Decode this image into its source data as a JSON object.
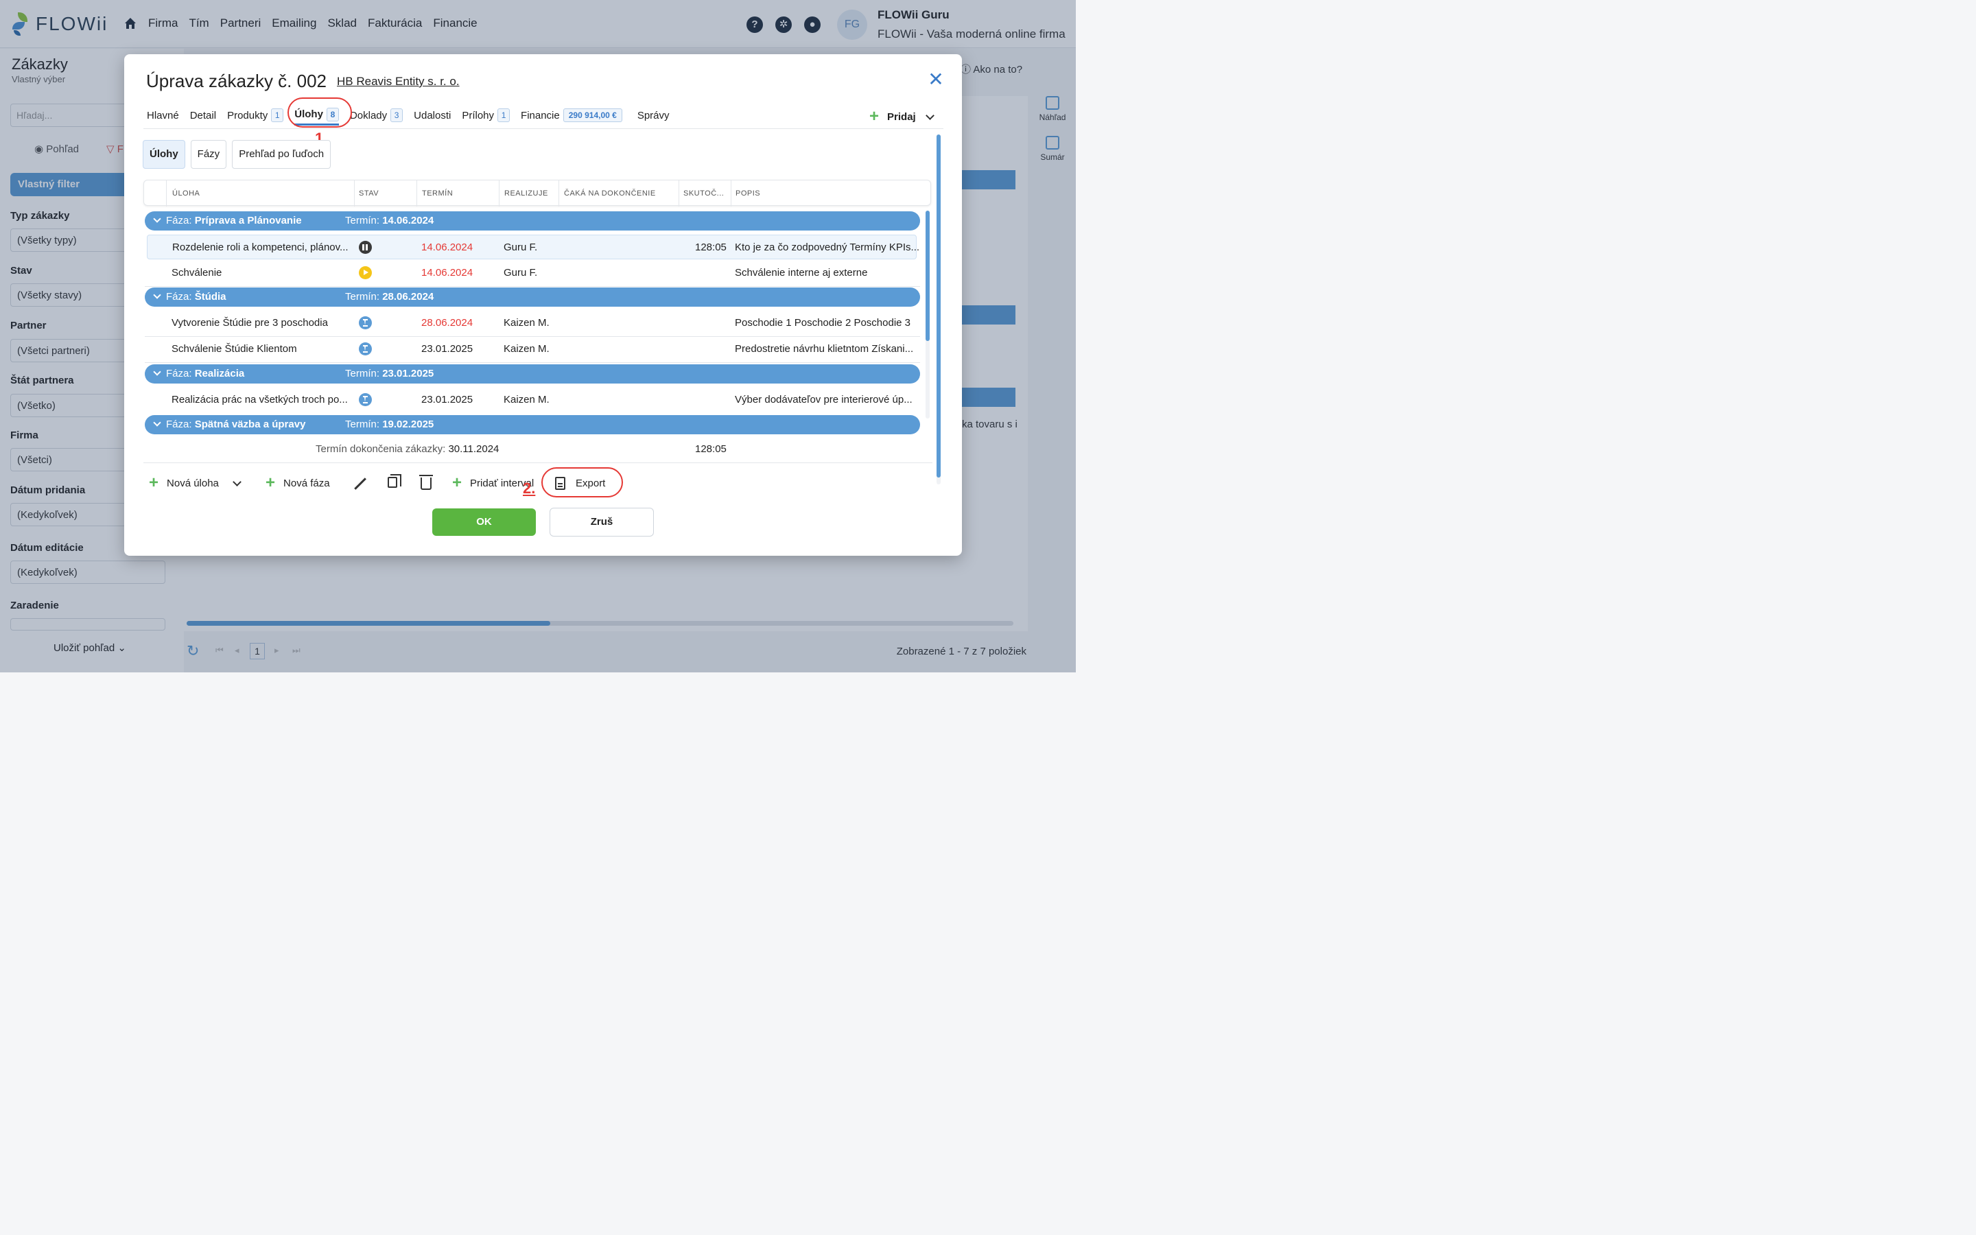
{
  "app": {
    "logo_text": "FLOWii",
    "nav": [
      "Firma",
      "Tím",
      "Partneri",
      "Emailing",
      "Sklad",
      "Fakturácia",
      "Financie"
    ],
    "user_initials": "FG",
    "user_name": "FLOWii Guru",
    "user_firm": "FLOWii - Vaša moderná online firma",
    "help_label": "Ako na to?"
  },
  "sidebar": {
    "title": "Zákazky",
    "subtitle": "Vlastný výber",
    "search_placeholder": "Hľadaj...",
    "view_tab": "Pohľad",
    "filter_tab": "F",
    "filter_button": "Vlastný filter",
    "filters": [
      {
        "label": "Typ zákazky",
        "value": "(Všetky typy)"
      },
      {
        "label": "Stav",
        "value": "(Všetky stavy)"
      },
      {
        "label": "Partner",
        "value": "(Všetci partneri)"
      },
      {
        "label": "Štát partnera",
        "value": "(Všetko)"
      },
      {
        "label": "Firma",
        "value": "(Všetci)"
      },
      {
        "label": "Dátum pridania",
        "value": "(Kedykoľvek)"
      },
      {
        "label": "Dátum editácie",
        "value": "(Kedykoľvek)"
      },
      {
        "label": "Zaradenie",
        "value": ""
      }
    ],
    "save_view": "Uložiť pohľad"
  },
  "right_panel": {
    "preview": "Náhľad",
    "summary": "Sumár",
    "partial_text": "ka tovaru s i"
  },
  "pager": {
    "page": "1",
    "info": "Zobrazené 1 - 7 z 7 položiek"
  },
  "modal": {
    "title": "Úprava zákazky č. 002",
    "partner": "HB Reavis Entity s. r. o.",
    "tabs": [
      {
        "label": "Hlavné",
        "badge": ""
      },
      {
        "label": "Detail",
        "badge": ""
      },
      {
        "label": "Produkty",
        "badge": "1"
      },
      {
        "label": "Úlohy",
        "badge": "8"
      },
      {
        "label": "Doklady",
        "badge": "3"
      },
      {
        "label": "Udalosti",
        "badge": ""
      },
      {
        "label": "Prílohy",
        "badge": "1"
      },
      {
        "label": "Financie",
        "badge": "290 914,00 €"
      },
      {
        "label": "Správy",
        "badge": ""
      }
    ],
    "add_label": "Pridaj",
    "annotations": {
      "one": "1.",
      "two": "2."
    },
    "subtabs": [
      "Úlohy",
      "Fázy",
      "Prehľad po ľuďoch"
    ],
    "columns": [
      "ÚLOHA",
      "STAV",
      "TERMÍN",
      "REALIZUJE",
      "ČAKÁ NA DOKONČENIE",
      "SKUTOČ...",
      "POPIS"
    ],
    "phase_prefix": "Fáza:",
    "term_prefix": "Termín:",
    "phases": [
      {
        "name": "Príprava a Plánovanie",
        "term": "14.06.2024"
      },
      {
        "name": "Štúdia",
        "term": "28.06.2024"
      },
      {
        "name": "Realizácia",
        "term": "23.01.2025"
      },
      {
        "name": "Spätná väzba a úpravy",
        "term": "19.02.2025"
      }
    ],
    "rows": [
      {
        "task": "Rozdelenie roli a kompetenci, plánov...",
        "status": "paused",
        "date": "14.06.2024",
        "who": "Guru F.",
        "actual": "128:05",
        "desc": "Kto je za čo zodpovedný Termíny KPIs..."
      },
      {
        "task": "Schválenie",
        "status": "in-progress",
        "date": "14.06.2024",
        "who": "Guru F.",
        "actual": "",
        "desc": "Schválenie interne aj externe"
      },
      {
        "task": "Vytvorenie Štúdie pre 3 poschodia",
        "status": "waiting",
        "date": "28.06.2024",
        "who": "Kaizen M.",
        "actual": "",
        "desc": "Poschodie 1 Poschodie 2 Poschodie 3"
      },
      {
        "task": "Schválenie Štúdie Klientom",
        "status": "waiting",
        "date": "23.01.2025",
        "who": "Kaizen M.",
        "actual": "",
        "desc": "Predostretie návrhu klietntom Získani..."
      },
      {
        "task": "Realizácia prác na všetkých troch po...",
        "status": "waiting",
        "date": "23.01.2025",
        "who": "Kaizen M.",
        "actual": "",
        "desc": "Výber dodávateľov pre interierové úp..."
      }
    ],
    "summary_label": "Termín dokončenia zákazky:",
    "summary_date": "30.11.2024",
    "summary_total": "128:05",
    "actions": {
      "new_task": "Nová úloha",
      "new_phase": "Nová fáza",
      "add_interval": "Pridať interval",
      "export": "Export"
    },
    "ok": "OK",
    "cancel": "Zruš"
  }
}
